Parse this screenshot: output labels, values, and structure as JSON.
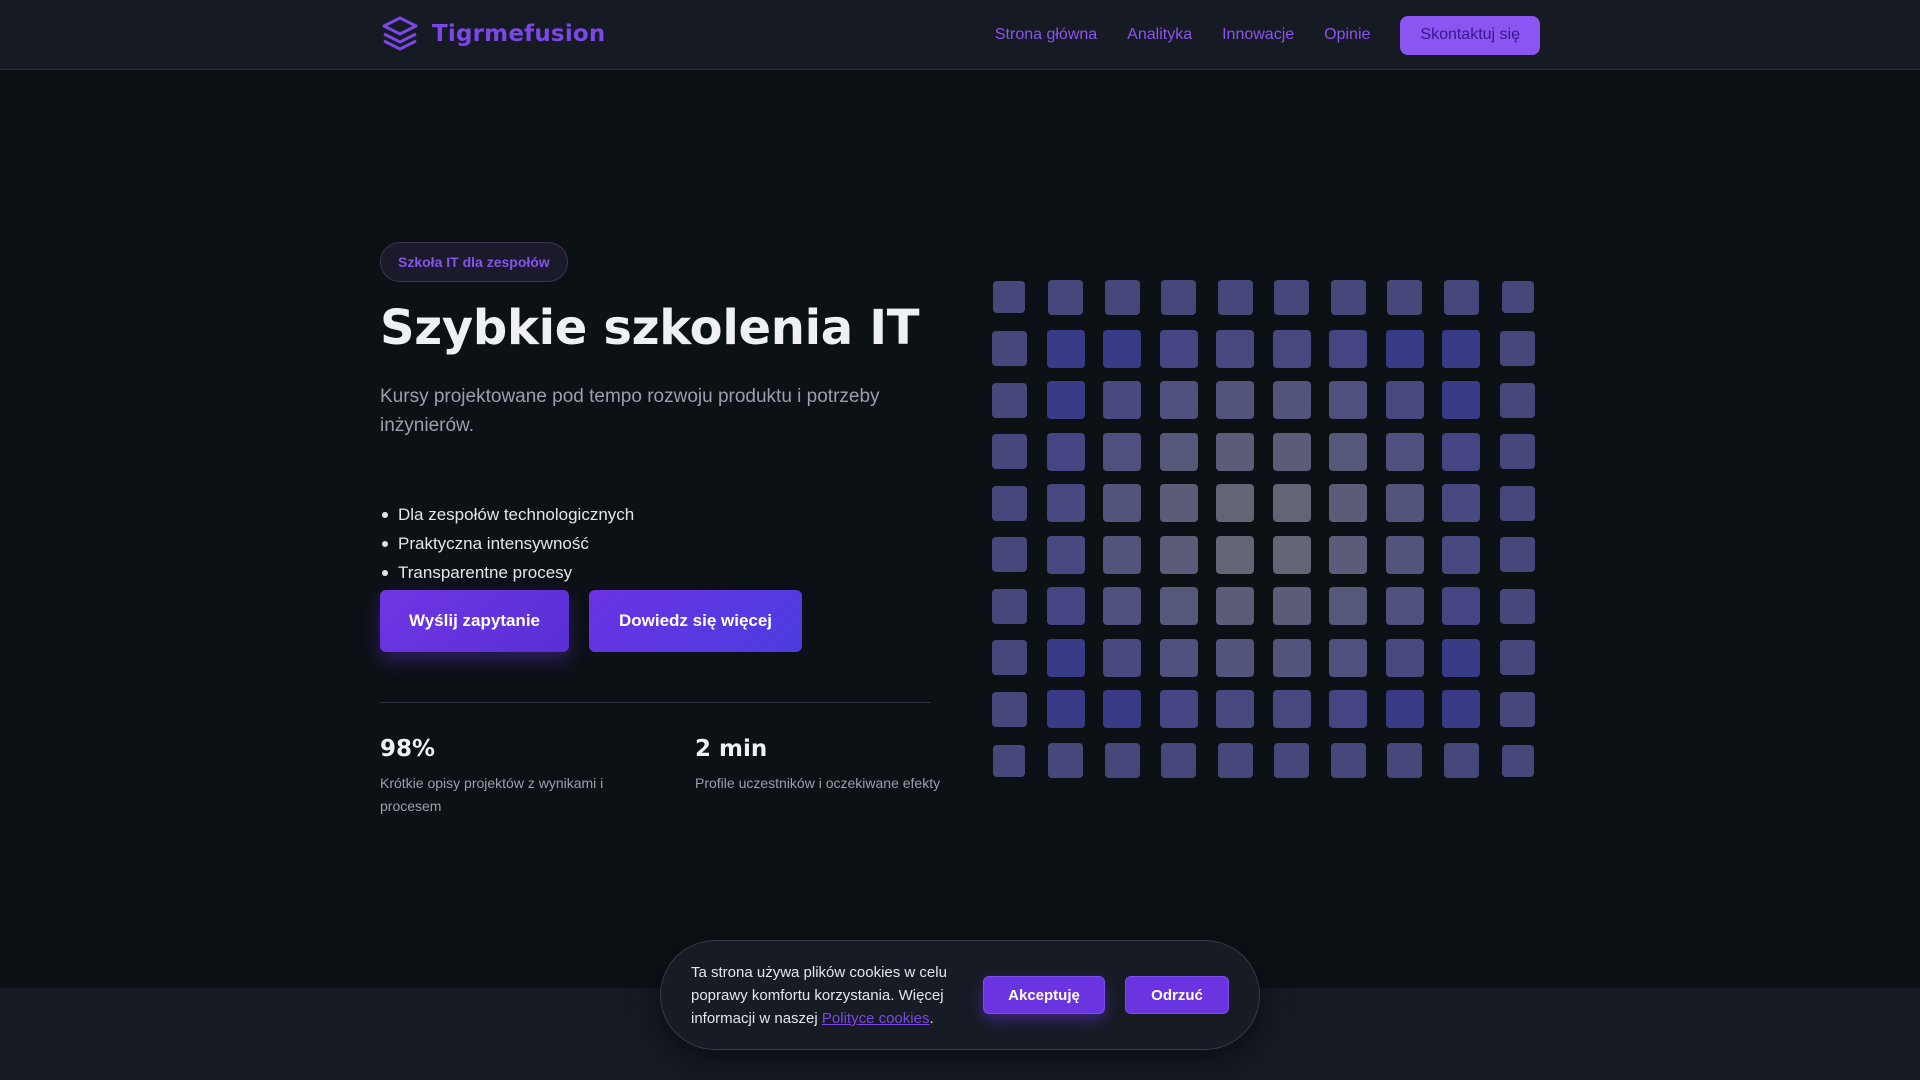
{
  "header": {
    "brand": "Tigrmefusion",
    "nav": [
      "Strona główna",
      "Analityka",
      "Innowacje",
      "Opinie"
    ],
    "contact": "Skontaktuj się"
  },
  "hero": {
    "badge": "Szkoła IT dla zespołów",
    "title": "Szybkie szkolenia IT",
    "subtitle": "Kursy projektowane pod tempo rozwoju produktu i potrzeby inżynierów.",
    "features": [
      "Dla zespołów technologicznych",
      "Praktyczna intensywność",
      "Transparentne procesy"
    ],
    "primary_cta": "Wyślij zapytanie",
    "secondary_cta": "Dowiedz się więcej"
  },
  "stats": [
    {
      "value": "98%",
      "desc": "Krótkie opisy projektów z wynikami i procesem"
    },
    {
      "value": "2 min",
      "desc": "Profile uczestników i oczekiwane efekty"
    }
  ],
  "cookie": {
    "text": "Ta strona używa plików cookies w celu poprawy komfortu korzystania. Więcej informacji w naszej ",
    "link": "Polityce cookies",
    "suffix": ".",
    "accept": "Akceptuję",
    "reject": "Odrzuć"
  },
  "colors": {
    "accent": "#7b47e6",
    "cell_blue": "#3a3b86",
    "cell_mid": "#4d4f7a",
    "cell_gray": "#666873"
  }
}
